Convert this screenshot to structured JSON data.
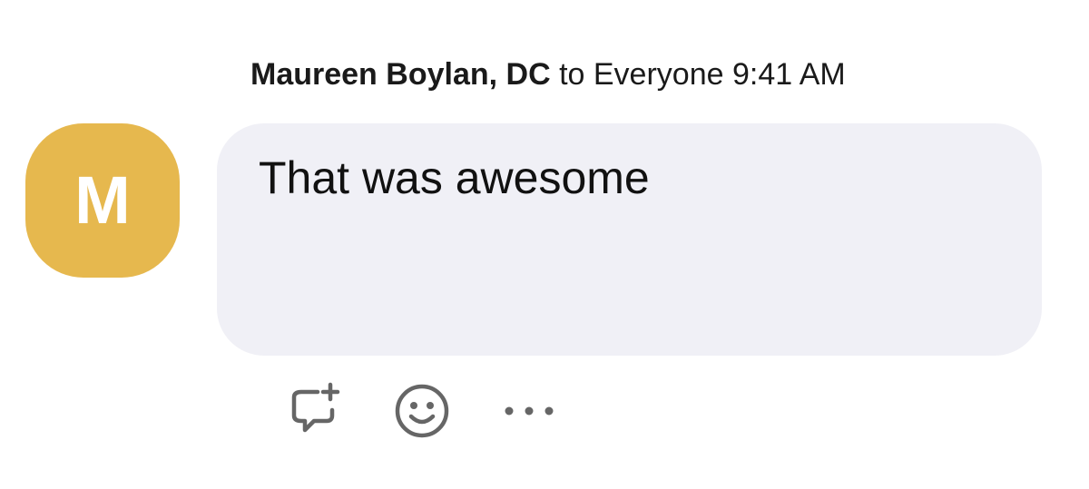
{
  "message": {
    "sender": "Maureen Boylan, DC",
    "recipient_text": "to Everyone",
    "time": "9:41 AM",
    "avatar_letter": "M",
    "text": "That was awesome"
  },
  "colors": {
    "avatar": "#E6B84E",
    "bubble": "#F0F0F6",
    "icons": "#666666"
  },
  "actions": [
    {
      "icon": "reply-thread-icon"
    },
    {
      "icon": "emoji-reaction-icon"
    },
    {
      "icon": "more-options-icon"
    }
  ]
}
